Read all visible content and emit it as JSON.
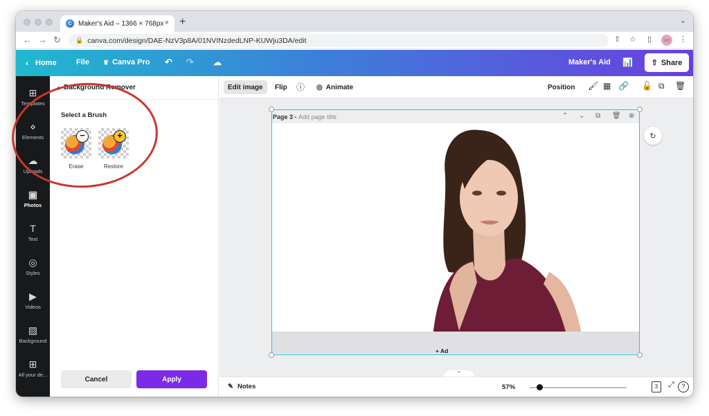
{
  "browser": {
    "tab_title": "Maker's Aid – 1366 × 768px",
    "url": "canva.com/design/DAE-NzV3p8A/01NVINzdedLNP-KUWju3DA/edit",
    "new_tab": "+"
  },
  "header": {
    "home": "Home",
    "file": "File",
    "canva_pro": "Canva Pro",
    "team_name": "Maker's Aid",
    "share": "Share"
  },
  "rail": {
    "items": [
      {
        "label": "Templates",
        "icon": "templates-icon"
      },
      {
        "label": "Elements",
        "icon": "elements-icon"
      },
      {
        "label": "Uploads",
        "icon": "uploads-icon"
      },
      {
        "label": "Photos",
        "icon": "photos-icon"
      },
      {
        "label": "Text",
        "icon": "text-icon"
      },
      {
        "label": "Styles",
        "icon": "styles-icon"
      },
      {
        "label": "Videos",
        "icon": "videos-icon"
      },
      {
        "label": "Background",
        "icon": "background-icon"
      },
      {
        "label": "All your de...",
        "icon": "apps-icon"
      }
    ]
  },
  "panel": {
    "title": "Background Remover",
    "brush_title": "Select a Brush",
    "erase_label": "Erase",
    "restore_label": "Restore",
    "cancel": "Cancel",
    "apply": "Apply"
  },
  "toolbar": {
    "edit_image": "Edit image",
    "flip": "Flip",
    "animate": "Animate",
    "position": "Position"
  },
  "page": {
    "number": "Page 3 - ",
    "title_placeholder": "Add page title",
    "add_page": "+ Ad"
  },
  "bottombar": {
    "notes": "Notes",
    "zoom": "57%",
    "zoom_fraction": 0.1,
    "page_count": "3",
    "help": "?"
  },
  "colors": {
    "header_start": "#1fb9cf",
    "header_end": "#6a3fe0",
    "apply_purple": "#7d2ae8",
    "selection_cyan": "#2ec4d6",
    "annotation_red": "#c7382b",
    "top_color": "#6e1d37"
  }
}
